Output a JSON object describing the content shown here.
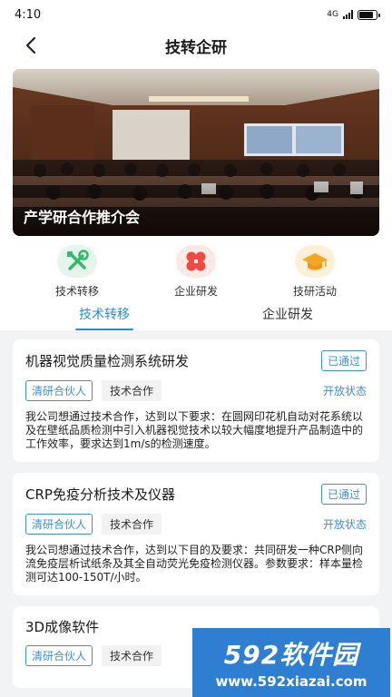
{
  "status_bar": {
    "time": "4:10",
    "network": "4G"
  },
  "header": {
    "title": "技转企研"
  },
  "banner": {
    "caption": "产学研合作推介会"
  },
  "quick_menu": [
    {
      "label": "技术转移",
      "icon": "tools-icon",
      "color": "#35b86a"
    },
    {
      "label": "企业研发",
      "icon": "clover-icon",
      "color": "#ef4b43"
    },
    {
      "label": "技研活动",
      "icon": "graduation-cap-icon",
      "color": "#f5a623"
    }
  ],
  "tabs": [
    {
      "label": "技术转移",
      "active": true
    },
    {
      "label": "企业研发",
      "active": false
    }
  ],
  "cards": [
    {
      "title": "机器视觉质量检测系统研发",
      "status": "已通过",
      "partner": "清研合伙人",
      "type": "技术合作",
      "state": "开放状态",
      "desc": "我公司想通过技术合作，达到以下要求：在圆网印花机自动对花系统以及在壁纸品质检测中引入机器视觉技术以较大幅度地提升产品制造中的工作效率，要求达到1m/s的检测速度。"
    },
    {
      "title": "CRP免疫分析技术及仪器",
      "status": "已通过",
      "partner": "清研合伙人",
      "type": "技术合作",
      "state": "开放状态",
      "desc": "我公司想通过技术合作，达到以下目的及要求：共同研发一种CRP侧向流免疫层析试纸条及其全自动荧光免疫检测仪器。参数要求：样本量检测可达100-150T/小时。"
    },
    {
      "title": "3D成像软件",
      "status": "",
      "partner": "清研合伙人",
      "type": "技术合作",
      "state": "",
      "desc": ""
    }
  ],
  "watermark": {
    "brand": "592软件园",
    "url": "www.592xiazai.com"
  }
}
